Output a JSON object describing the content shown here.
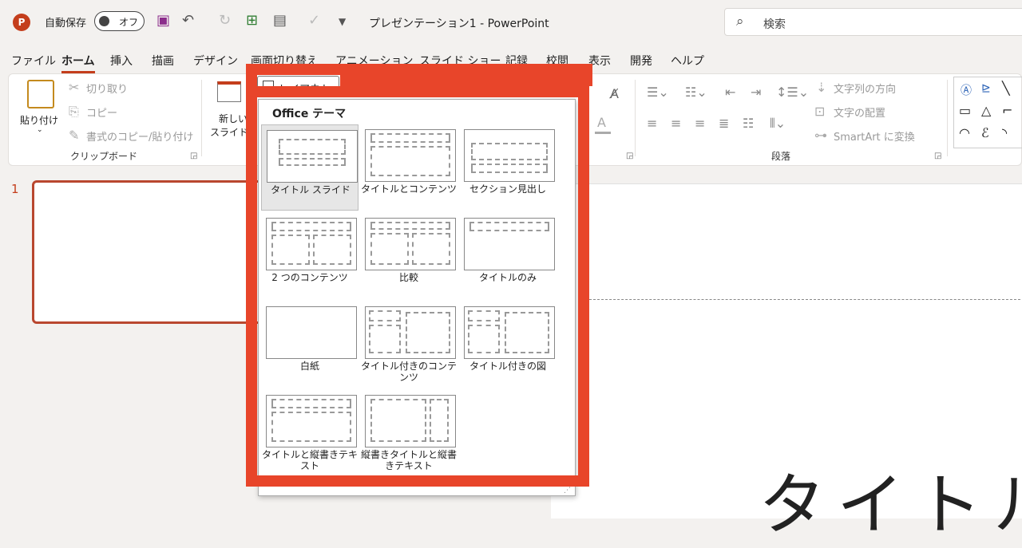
{
  "titlebar": {
    "app_logo": "P",
    "autosave_label": "自動保存",
    "autosave_state": "オフ",
    "doc_title": "プレゼンテーション1  -  PowerPoint",
    "search_placeholder": "検索"
  },
  "menu": [
    "ファイル",
    "ホーム",
    "挿入",
    "描画",
    "デザイン",
    "画面切り替え",
    "アニメーション",
    "スライド ショー",
    "記録",
    "校閲",
    "表示",
    "開発",
    "ヘルプ"
  ],
  "ribbon": {
    "paste": "貼り付け",
    "cut": "切り取り",
    "copy": "コピー",
    "format_painter": "書式のコピー/貼り付け",
    "clipboard_group": "クリップボード",
    "new_slide_1": "新しい",
    "new_slide_2": "スライド",
    "layout_button": "レイアウト",
    "text_direction": "文字列の方向",
    "align_text": "文字の配置",
    "smartart": "SmartArt に変換",
    "paragraph_group": "段落"
  },
  "slide": {
    "number": "1",
    "big_title": "タイトル"
  },
  "layout_panel": {
    "header": "Office テーマ",
    "items": [
      {
        "name": "タイトル スライド"
      },
      {
        "name": "タイトルとコンテンツ"
      },
      {
        "name": "セクション見出し"
      },
      {
        "name": "2 つのコンテンツ"
      },
      {
        "name": "比較"
      },
      {
        "name": "タイトルのみ"
      },
      {
        "name": "白紙"
      },
      {
        "name": "タイトル付きのコンテンツ"
      },
      {
        "name": "タイトル付きの図"
      },
      {
        "name": "タイトルと縦書きテキスト"
      },
      {
        "name": "縦書きタイトルと縦書きテキスト"
      }
    ]
  },
  "colors": {
    "accent": "#c43e1c",
    "highlight": "#e8452a"
  }
}
